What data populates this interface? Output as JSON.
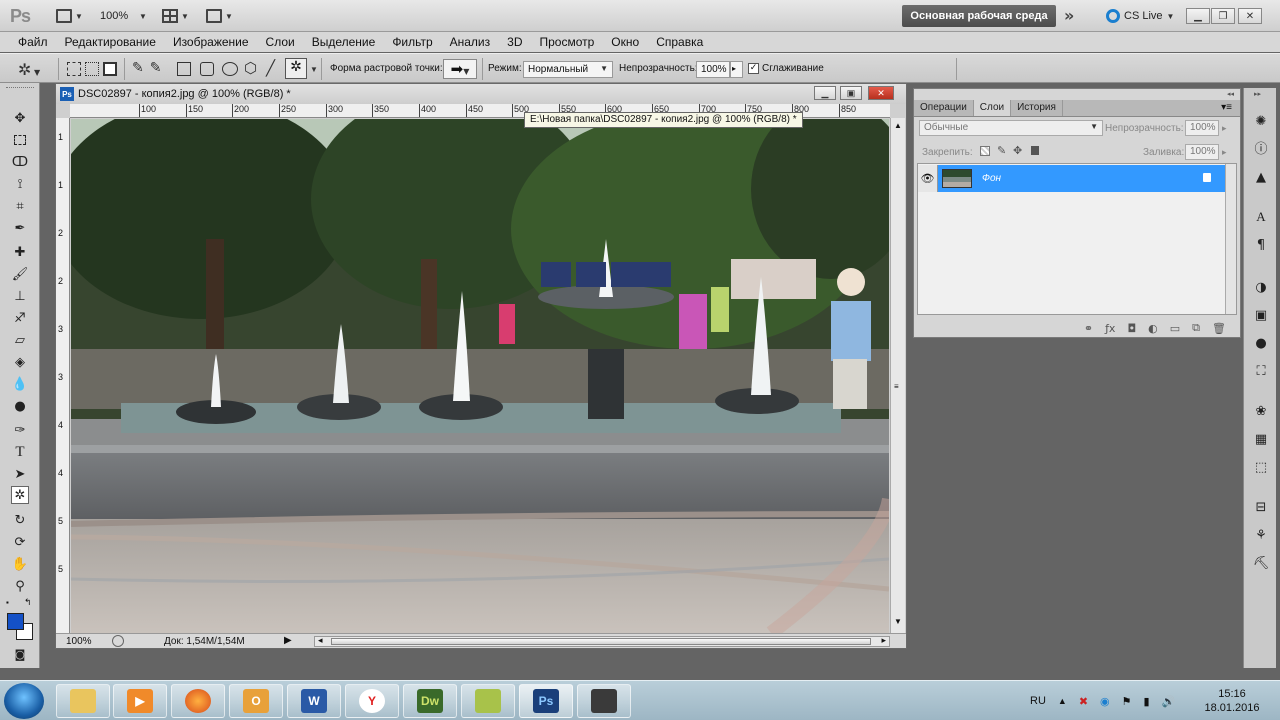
{
  "appbar": {
    "zoom": "100%",
    "workspace": "Основная рабочая среда",
    "cs_live": "CS Live",
    "more": "»"
  },
  "menu": [
    "Файл",
    "Редактирование",
    "Изображение",
    "Слои",
    "Выделение",
    "Фильтр",
    "Анализ",
    "3D",
    "Просмотр",
    "Окно",
    "Справка"
  ],
  "options": {
    "shape_label": "Форма растровой точки:",
    "mode_label": "Режим:",
    "mode_value": "Нормальный",
    "opacity_label": "Непрозрачность:",
    "opacity_value": "100%",
    "antialias_label": "Сглаживание",
    "antialias_checked": true
  },
  "document": {
    "title": "DSC02897 - копия2.jpg @ 100% (RGB/8) *",
    "ps_badge": "Ps",
    "zoom": "100%",
    "doc_info": "Док: 1,54M/1,54M",
    "ruler_ticks": [
      "100",
      "150",
      "200",
      "250",
      "300",
      "350",
      "400",
      "450",
      "500",
      "550",
      "600",
      "650",
      "700",
      "750",
      "800",
      "850"
    ],
    "v_ruler_ticks": [
      "1",
      "1",
      "2",
      "2",
      "3",
      "3",
      "4",
      "4",
      "5",
      "5"
    ]
  },
  "tooltip": "E:\\Новая папка\\DSC02897 - копия2.jpg @ 100% (RGB/8) *",
  "layers_panel": {
    "tabs": [
      "Операции",
      "Слои",
      "История"
    ],
    "active_tab": "Слои",
    "blend_mode": "Обычные",
    "opacity_label": "Непрозрачность:",
    "opacity_value": "100%",
    "lock_label": "Закрепить:",
    "fill_label": "Заливка:",
    "fill_value": "100%",
    "layer_name": "Фон"
  },
  "taskbar": {
    "lang": "RU",
    "time": "15:16",
    "date": "18.01.2016",
    "apps": [
      "explorer",
      "media-player",
      "firefox",
      "outlook",
      "word",
      "yandex",
      "dreamweaver",
      "notes",
      "photoshop",
      "camera"
    ]
  },
  "colors": {
    "accent": "#3399ff",
    "foreground_swatch": "#1451c7",
    "background_swatch": "#ffffff",
    "close": "#c9412e"
  }
}
